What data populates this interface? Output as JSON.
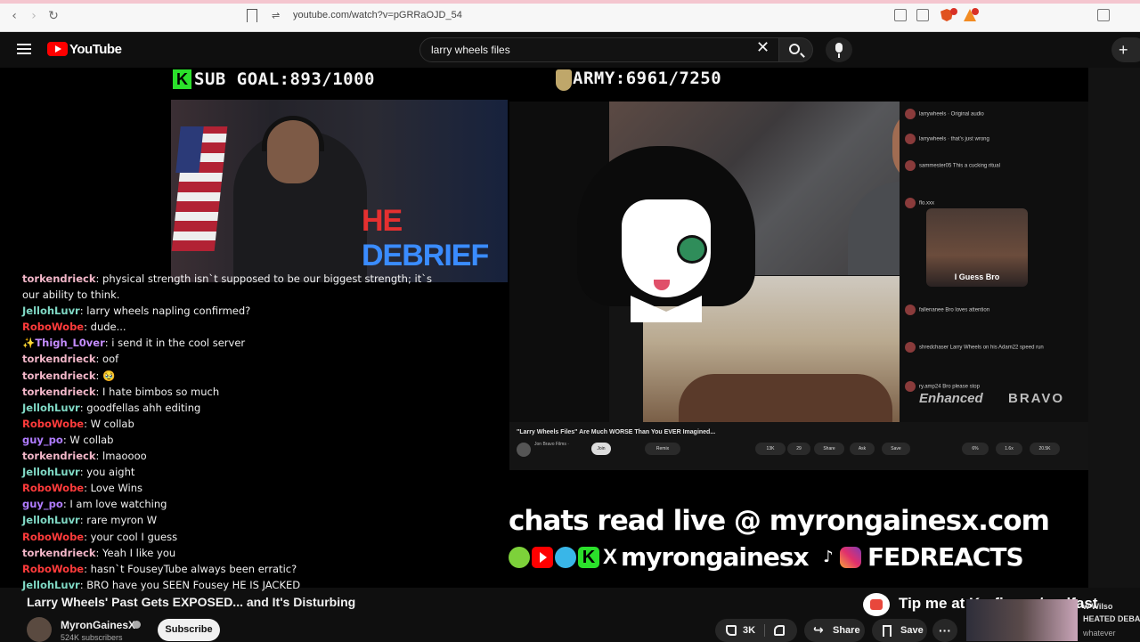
{
  "browser": {
    "url": "youtube.com/watch?v=pGRRaOJD_54",
    "back": "‹",
    "forward": "›",
    "reload": "↻",
    "site_info": "⇌"
  },
  "header": {
    "logo_text": "YouTube",
    "search_value": "larry wheels files",
    "clear_icon": "✕",
    "create_label": "+"
  },
  "video": {
    "overlay": {
      "sub_goal": "SUB GOAL:893/1000",
      "kick_letter": "K",
      "army": "ARMY:6961/7250",
      "webcam_sign_he": "HE",
      "webcam_sign_debrief": " DEBRIEF"
    },
    "reaction": {
      "inner_title": "\"Larry Wheels Files\" Are Much WORSE Than You EVER Imagined...",
      "inner_channel": "Jon Bravo Films ·",
      "inner_join": "Join",
      "inner_remix": "Remix",
      "inner_likes": "13K",
      "inner_dislike": "29",
      "inner_share": "Share",
      "inner_ask": "Ask",
      "inner_save": "Save",
      "inner_dims": [
        "6%",
        "1.6x",
        "20.5K"
      ],
      "guess_bro": "I Guess Bro",
      "enhanced": "Enhanced",
      "bravo": "BRAVO",
      "comments": [
        "larrywheels · Original audio",
        "larrywheels · that's just wrong",
        "sammester05 This a cucking ritual",
        "flo.xxx",
        "fallenanee Bro loves attention",
        "shredchaser Larry Wheels on his Adam22 speed run",
        "ry.amp24 Bro please stop"
      ]
    },
    "promo": {
      "chats_read": "chats read live @ myrongainesx.com",
      "handle": "myrongainesx",
      "handle2": "FEDREACTS",
      "kick": "K",
      "x": "X",
      "tiktok": "♪"
    },
    "chat": [
      {
        "user": "torkendrieck",
        "color": "#f2b6c8",
        "text": "physical strength isn`t supposed to be our biggest strength; it`s"
      },
      {
        "user": "",
        "color": "#f1f1f1",
        "text": "our ability to think."
      },
      {
        "user": "JellohLuvr",
        "color": "#7fd8c4",
        "text": "larry wheels napling confirmed?"
      },
      {
        "user": "RoboWobe",
        "color": "#ff3b3b",
        "text": "dude..."
      },
      {
        "user": "✨Thigh_L0ver",
        "color": "#c48cff",
        "text": "i send it in the cool server"
      },
      {
        "user": "torkendrieck",
        "color": "#f2b6c8",
        "text": "oof"
      },
      {
        "user": "torkendrieck",
        "color": "#f2b6c8",
        "text": "🥹"
      },
      {
        "user": "torkendrieck",
        "color": "#f2b6c8",
        "text": "I hate bimbos so much"
      },
      {
        "user": "JellohLuvr",
        "color": "#7fd8c4",
        "text": "goodfellas ahh editing"
      },
      {
        "user": "RoboWobe",
        "color": "#ff3b3b",
        "text": "W collab"
      },
      {
        "user": "guy_po",
        "color": "#b07cff",
        "text": "W collab"
      },
      {
        "user": "torkendrieck",
        "color": "#f2b6c8",
        "text": "lmaoooo"
      },
      {
        "user": "JellohLuvr",
        "color": "#7fd8c4",
        "text": "you aight"
      },
      {
        "user": "RoboWobe",
        "color": "#ff3b3b",
        "text": "Love Wins"
      },
      {
        "user": "guy_po",
        "color": "#b07cff",
        "text": "I am love watching"
      },
      {
        "user": "JellohLuvr",
        "color": "#7fd8c4",
        "text": "rare myron W"
      },
      {
        "user": "RoboWobe",
        "color": "#ff3b3b",
        "text": "your cool I guess"
      },
      {
        "user": "torkendrieck",
        "color": "#f2b6c8",
        "text": "Yeah I like you"
      },
      {
        "user": "RoboWobe",
        "color": "#ff3b3b",
        "text": "hasn`t FouseyTube always been erratic?"
      },
      {
        "user": "JellohLuvr",
        "color": "#7fd8c4",
        "text": "BRO have you SEEN Fousey HE IS JACKED"
      }
    ]
  },
  "below": {
    "title": "Larry Wheels' Past Gets EXPOSED... and It's Disturbing",
    "kofi": "Tip me at Ko-fi.com/godfast",
    "channel_name": "MyronGainesX",
    "subscribers": "524K subscribers",
    "subscribe": "Subscribe",
    "likes": "3K",
    "share": "Share",
    "save": "Save",
    "more": "···",
    "share_glyph": "↪",
    "mini_lines": [
      "w Wilso",
      "HEATED DEBA",
      "whatever"
    ]
  },
  "colors": {
    "accent_red": "#ff0000",
    "background": "#0f0f0f",
    "kick_green": "#2be02b"
  }
}
